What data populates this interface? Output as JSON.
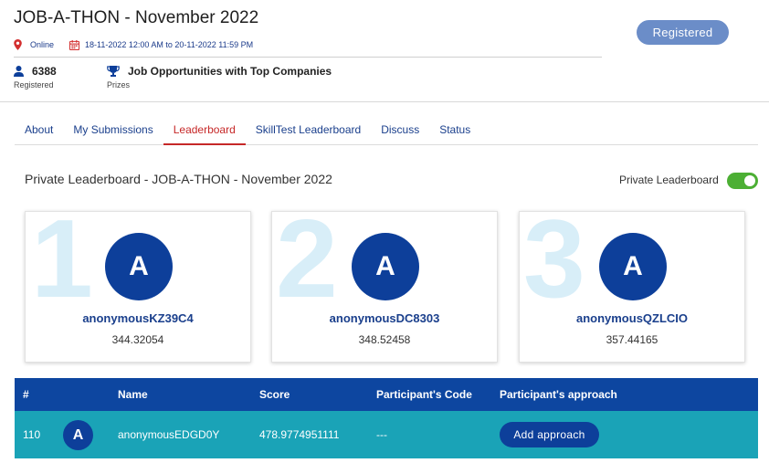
{
  "event": {
    "title": "JOB-A-THON - November 2022",
    "mode": "Online",
    "dates": "18-11-2022 12:00 AM to 20-11-2022 11:59 PM",
    "registered_count": "6388",
    "registered_label": "Registered",
    "prizes_value": "Job Opportunities with Top Companies",
    "prizes_label": "Prizes",
    "register_button": "Registered"
  },
  "tabs": [
    {
      "label": "About"
    },
    {
      "label": "My Submissions"
    },
    {
      "label": "Leaderboard"
    },
    {
      "label": "SkillTest Leaderboard"
    },
    {
      "label": "Discuss"
    },
    {
      "label": "Status"
    }
  ],
  "active_tab": "Leaderboard",
  "leaderboard": {
    "title": "Private Leaderboard - JOB-A-THON - November 2022",
    "toggle_label": "Private Leaderboard",
    "toggle_on": true,
    "toggle_color": "#4caf34",
    "top3": [
      {
        "rank": "1",
        "initial": "A",
        "name": "anonymousKZ39C4",
        "score": "344.32054"
      },
      {
        "rank": "2",
        "initial": "A",
        "name": "anonymousDC8303",
        "score": "348.52458"
      },
      {
        "rank": "3",
        "initial": "A",
        "name": "anonymousQZLCIO",
        "score": "357.44165"
      }
    ]
  },
  "table": {
    "headers": {
      "rank": "#",
      "name": "Name",
      "score": "Score",
      "code": "Participant's Code",
      "approach": "Participant's approach"
    },
    "row": {
      "rank": "110",
      "initial": "A",
      "name": "anonymousEDGD0Y",
      "score": "478.9774951111",
      "code": "---",
      "approach_button": "Add approach"
    },
    "header_color": "#0d46a0",
    "row_color": "#1aa3b7"
  },
  "icons": {
    "location": "map-pin-icon",
    "calendar": "calendar-icon",
    "users": "user-icon",
    "prizes": "trophy-icon"
  }
}
